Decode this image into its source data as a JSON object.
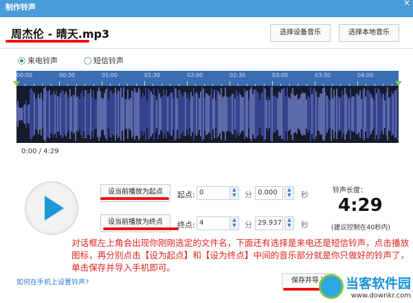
{
  "window": {
    "title": "制作铃声",
    "close": "×"
  },
  "file_name": "周杰伦 - 晴天.mp3",
  "buttons": {
    "device_music": "选择设备音乐",
    "local_music": "选择本地音乐",
    "set_start": "设当前播放为起点",
    "set_end": "设当前播放为终点",
    "save_import": "保存并导入"
  },
  "radios": [
    {
      "label": "来电铃声",
      "checked": true
    },
    {
      "label": "短信铃声",
      "checked": false
    }
  ],
  "ruler_ticks": [
    "00:00",
    "00:30",
    "01:00",
    "01:30",
    "02:00",
    "02:30",
    "03:00",
    "03:30",
    "04:00"
  ],
  "time_display": "0:00 / 4:29",
  "start": {
    "label": "起点:",
    "min": "0",
    "min_unit": "分",
    "sec": "0.000",
    "sec_unit": "秒"
  },
  "end": {
    "label": "终点:",
    "min": "4",
    "min_unit": "分",
    "sec": "29.937",
    "sec_unit": "秒"
  },
  "length": {
    "label": "铃声长度：",
    "value": "4:29",
    "hint": "(建议控制在40秒内)"
  },
  "annotation": "对话框左上角会出现你刚刚选定的文件名，下面还有选择是来电还是短信铃声，点击播放图标，再分别点击【设为起点】和【设为终点】中间的音乐部分就是你只做好的铃声了，单击保存并导入手机即可。",
  "help_link": "如何在手机上设置铃声?",
  "watermark": {
    "name": "当客软件园",
    "url": "www.downkr.com"
  }
}
